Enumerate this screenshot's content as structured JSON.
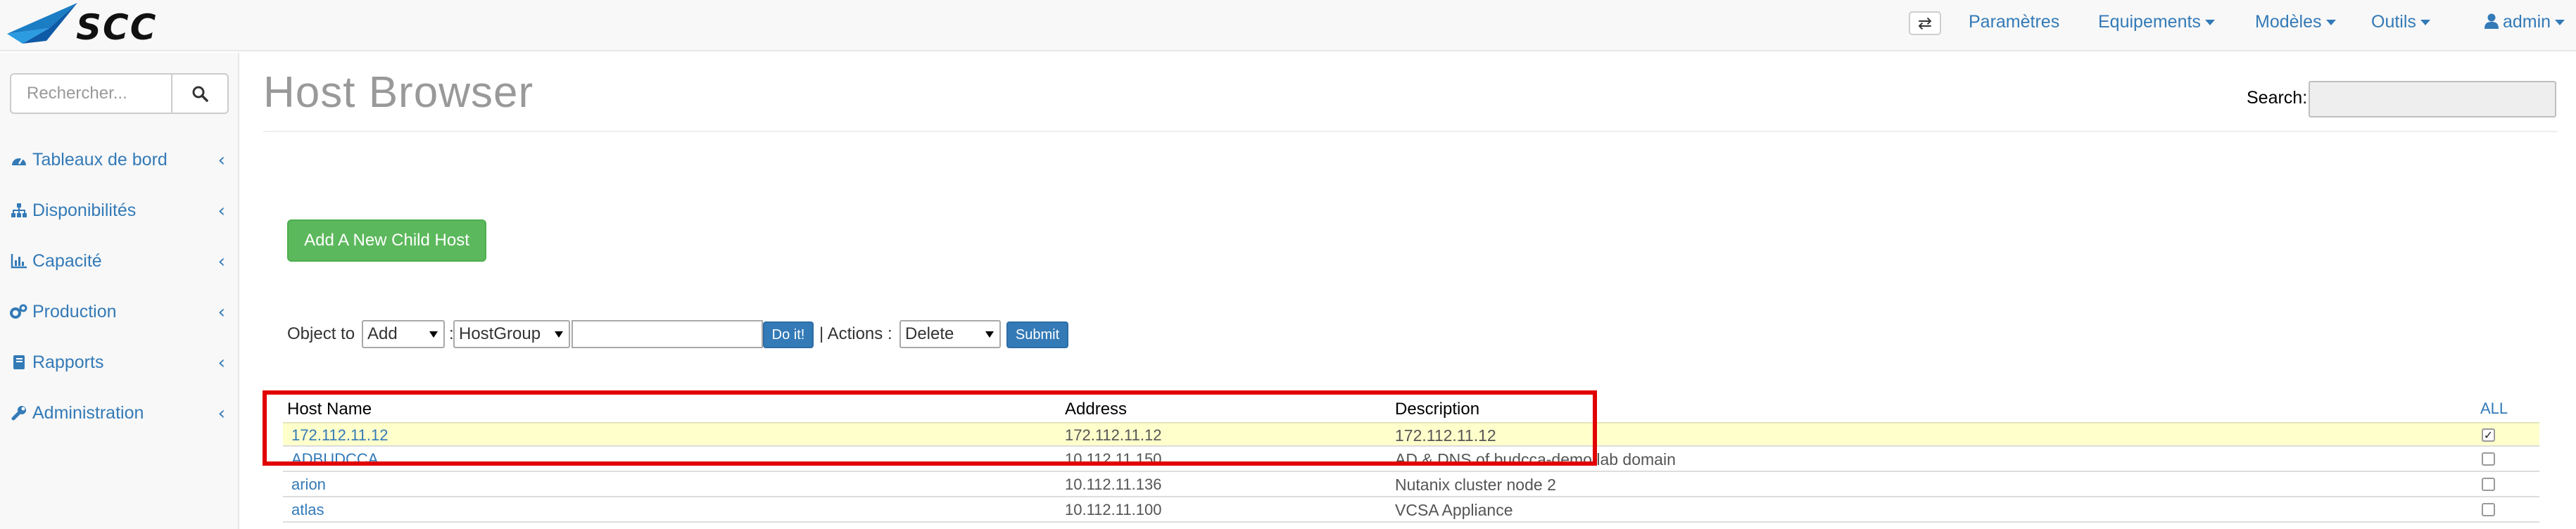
{
  "header": {
    "logo_text": "SCC",
    "nav": [
      {
        "label": "Paramètres",
        "dropdown": false
      },
      {
        "label": "Equipements",
        "dropdown": true
      },
      {
        "label": "Modèles",
        "dropdown": true
      },
      {
        "label": "Outils",
        "dropdown": true
      },
      {
        "label": "admin",
        "dropdown": true
      }
    ]
  },
  "sidebar": {
    "search_placeholder": "Rechercher...",
    "items": [
      {
        "label": "Tableaux de bord",
        "icon": "dashboard-icon"
      },
      {
        "label": "Disponibilités",
        "icon": "sitemap-icon"
      },
      {
        "label": "Capacité",
        "icon": "bar-chart-icon"
      },
      {
        "label": "Production",
        "icon": "gears-icon"
      },
      {
        "label": "Rapports",
        "icon": "book-icon"
      },
      {
        "label": "Administration",
        "icon": "wrench-icon"
      }
    ]
  },
  "main": {
    "title": "Host Browser",
    "search_label": "Search:",
    "add_child_label": "Add A New Child Host",
    "toolbar": {
      "object_to_label": "Object to",
      "add_select": "Add",
      "colon": ":",
      "group_select": "HostGroup",
      "do_it_label": "Do it!",
      "actions_label": "| Actions :",
      "action_select": "Delete",
      "submit_label": "Submit"
    },
    "table": {
      "headers": {
        "name": "Host Name",
        "address": "Address",
        "description": "Description",
        "all": "ALL"
      },
      "rows": [
        {
          "name": "172.112.11.12",
          "address": "172.112.11.12",
          "description": "172.112.11.12",
          "checked": true
        },
        {
          "name": "ADBUDCCA",
          "address": "10.112.11.150",
          "description": "AD & DNS of budcca-demo.lab domain",
          "checked": false
        },
        {
          "name": "arion",
          "address": "10.112.11.136",
          "description": "Nutanix cluster node 2",
          "checked": false
        },
        {
          "name": "atlas",
          "address": "10.112.11.100",
          "description": "VCSA Appliance",
          "checked": false
        }
      ]
    }
  },
  "colors": {
    "link": "#337ab7",
    "success": "#5cb85c",
    "highlight_row": "#ffffcc",
    "annotation_box": "#e10000"
  }
}
